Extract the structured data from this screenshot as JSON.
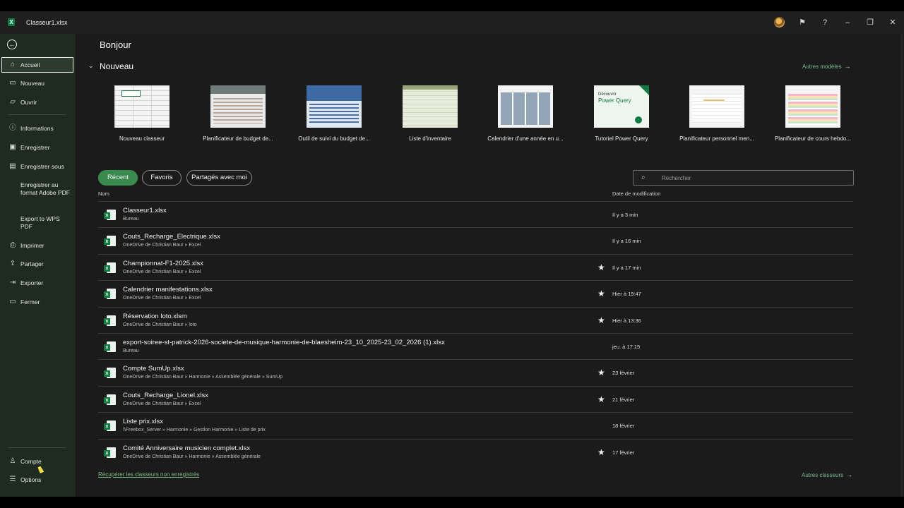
{
  "window": {
    "title": "Classeur1.xlsx",
    "help": "?",
    "minimize": "–",
    "restore": "❐",
    "close": "✕"
  },
  "sidebar": {
    "items": [
      {
        "label": "Accueil",
        "icon": "home-icon",
        "glyph": "⌂"
      },
      {
        "label": "Nouveau",
        "icon": "new-doc-icon",
        "glyph": "▭"
      },
      {
        "label": "Ouvrir",
        "icon": "folder-icon",
        "glyph": "▱"
      },
      {
        "label": "Informations",
        "icon": "info-icon",
        "glyph": "ⓘ"
      },
      {
        "label": "Enregistrer",
        "icon": "save-icon",
        "glyph": "▣"
      },
      {
        "label": "Enregistrer sous",
        "icon": "save-as-icon",
        "glyph": "▤"
      },
      {
        "label": "Enregistrer au format Adobe PDF",
        "icon": "",
        "glyph": ""
      },
      {
        "label": "Export to WPS PDF",
        "icon": "",
        "glyph": ""
      },
      {
        "label": "Imprimer",
        "icon": "print-icon",
        "glyph": "⎙"
      },
      {
        "label": "Partager",
        "icon": "share-icon",
        "glyph": "⇪"
      },
      {
        "label": "Exporter",
        "icon": "export-icon",
        "glyph": "⇥"
      },
      {
        "label": "Fermer",
        "icon": "close-folder-icon",
        "glyph": "▭"
      },
      {
        "label": "Compte",
        "icon": "account-icon",
        "glyph": "♙"
      },
      {
        "label": "Options",
        "icon": "options-icon",
        "glyph": "☰"
      }
    ]
  },
  "main": {
    "greeting": "Bonjour",
    "new_section": {
      "title": "Nouveau",
      "more_link": "Autres modèles"
    },
    "templates": [
      {
        "name": "Nouveau classeur"
      },
      {
        "name": "Planificateur de budget de..."
      },
      {
        "name": "Outil de suivi du budget de..."
      },
      {
        "name": "Liste d'inventaire"
      },
      {
        "name": "Calendrier d'une année en u..."
      },
      {
        "name": "Tutoriel Power Query",
        "thumb_line1": "Découvrir",
        "thumb_line2": "Power Query"
      },
      {
        "name": "Planificateur personnel men..."
      },
      {
        "name": "Planificateur de cours hebdo..."
      }
    ],
    "filters": [
      "Récent",
      "Favoris",
      "Partagés avec moi"
    ],
    "search_placeholder": "Rechercher",
    "columns": {
      "name": "Nom",
      "date": "Date de modification"
    },
    "files": [
      {
        "name": "Classeur1.xlsx",
        "path": "Bureau",
        "date": "Il y a 3 min",
        "pinned": ""
      },
      {
        "name": "Couts_Recharge_Electrique.xlsx",
        "path": "OneDrive de Christian Baur » Excel",
        "date": "Il y a 16 min",
        "pinned": ""
      },
      {
        "name": "Championnat-F1-2025.xlsx",
        "path": "OneDrive de Christian Baur » Excel",
        "date": "Il y a 17 min",
        "pinned": "★"
      },
      {
        "name": "Calendrier manifestations.xlsx",
        "path": "OneDrive de Christian Baur » Excel",
        "date": "Hier à 19:47",
        "pinned": "★"
      },
      {
        "name": "Réservation loto.xlsm",
        "path": "OneDrive de Christian Baur » loto",
        "date": "Hier à 13:36",
        "pinned": "★"
      },
      {
        "name": "export-soiree-st-patrick-2026-societe-de-musique-harmonie-de-blaesheim-23_10_2025-23_02_2026 (1).xlsx",
        "path": "Bureau",
        "date": "jeu. à 17:15",
        "pinned": ""
      },
      {
        "name": "Compte SumUp.xlsx",
        "path": "OneDrive de Christian Baur » Harmonie » Assemblée générale » SumUp",
        "date": "23 février",
        "pinned": "★"
      },
      {
        "name": "Couts_Recharge_Lionel.xlsx",
        "path": "OneDrive de Christian Baur » Excel",
        "date": "21 février",
        "pinned": "★"
      },
      {
        "name": "Liste prix.xlsx",
        "path": "\\\\Freebox_Server » Harmonie » Gestion Harmonie » Liste de prix",
        "date": "18 février",
        "pinned": ""
      },
      {
        "name": "Comité Anniversaire musicien complet.xlsx",
        "path": "OneDrive de Christian Baur » Harmonie » Assemblée générale",
        "date": "17 février",
        "pinned": "★"
      }
    ],
    "recover_link": "Récupérer les classeurs non enregistrés",
    "more_files": "Autres classeurs"
  },
  "colors": {
    "sidebar_bg": "#1e2b1e",
    "accent_green": "#3a8a4f",
    "link_green": "#7ab98a",
    "excel_green": "#107c41"
  }
}
